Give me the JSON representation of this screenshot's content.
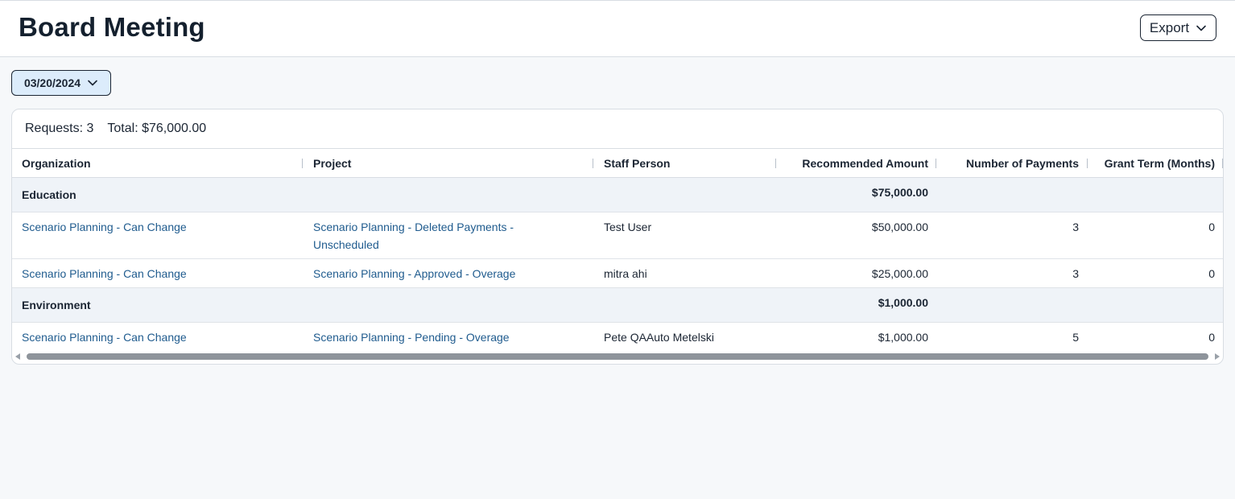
{
  "header": {
    "title": "Board Meeting",
    "export_label": "Export"
  },
  "filters": {
    "date_value": "03/20/2024"
  },
  "summary": {
    "requests_label": "Requests: 3",
    "total_label": "Total: $76,000.00"
  },
  "table": {
    "columns": [
      "Organization",
      "Project",
      "Staff Person",
      "Recommended Amount",
      "Number of Payments",
      "Grant Term (Months)"
    ],
    "groups": [
      {
        "name": "Education",
        "total": "$75,000.00",
        "rows": [
          {
            "organization": "Scenario Planning - Can Change",
            "project": "Scenario Planning - Deleted Payments - Unscheduled",
            "staff": "Test User",
            "amount": "$50,000.00",
            "payments": "3",
            "term": "0"
          },
          {
            "organization": "Scenario Planning - Can Change",
            "project": "Scenario Planning - Approved - Overage",
            "staff": "mitra ahi",
            "amount": "$25,000.00",
            "payments": "3",
            "term": "0"
          }
        ]
      },
      {
        "name": "Environment",
        "total": "$1,000.00",
        "rows": [
          {
            "organization": "Scenario Planning - Can Change",
            "project": "Scenario Planning - Pending - Overage",
            "staff": "Pete QAAuto Metelski",
            "amount": "$1,000.00",
            "payments": "5",
            "term": "0"
          }
        ]
      }
    ]
  }
}
